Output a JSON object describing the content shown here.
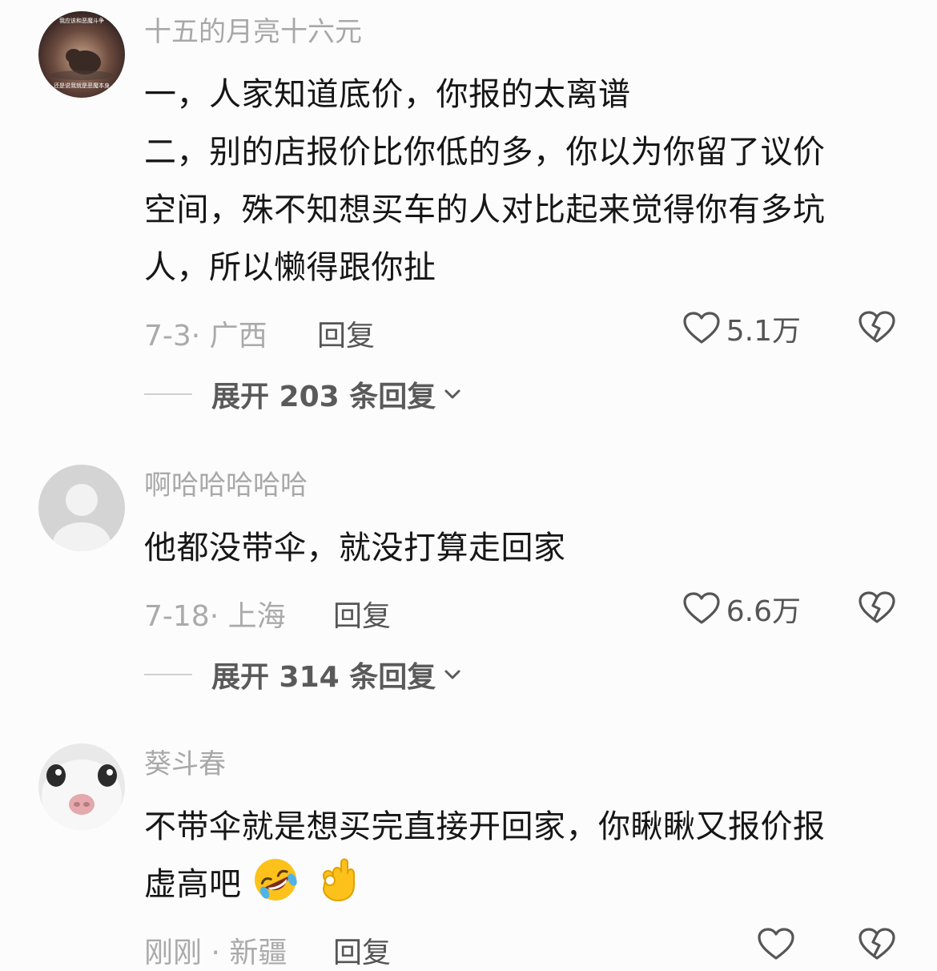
{
  "comments": [
    {
      "username": "十五的月亮十六元",
      "lines": [
        "一，人家知道底价，你报的太离谱",
        "二，别的店报价比你低的多，你以为你留了议价",
        "空间，殊不知想买车的人对比起来觉得你有多坑",
        "人，所以懒得跟你扯"
      ],
      "avatar_caption_top": "我应该和恶魔斗争",
      "avatar_caption_bottom": "还是说我就是恶魔本身",
      "date_location": "7-3· 广西",
      "reply_label": "回复",
      "likes": "5.1万",
      "expand_label": "展开 203 条回复"
    },
    {
      "username": "啊哈哈哈哈哈",
      "lines": [
        "他都没带伞，就没打算走回家"
      ],
      "date_location": "7-18· 上海",
      "reply_label": "回复",
      "likes": "6.6万",
      "expand_label": "展开 314 条回复"
    },
    {
      "username": "葵斗春",
      "lines": [
        "不带伞就是想买完直接开回家，你瞅瞅又报价报",
        "虚高吧"
      ],
      "emojis": [
        "rolling-laughing-emoji",
        "ok-hand-emoji"
      ],
      "date_location": "刚刚 · 新疆",
      "reply_label": "回复",
      "likes": ""
    }
  ],
  "colors": {
    "username": "#a8a8a8",
    "text": "#161616",
    "meta": "#aaaaaa",
    "action": "#555555",
    "background": "#fcfcfc"
  }
}
